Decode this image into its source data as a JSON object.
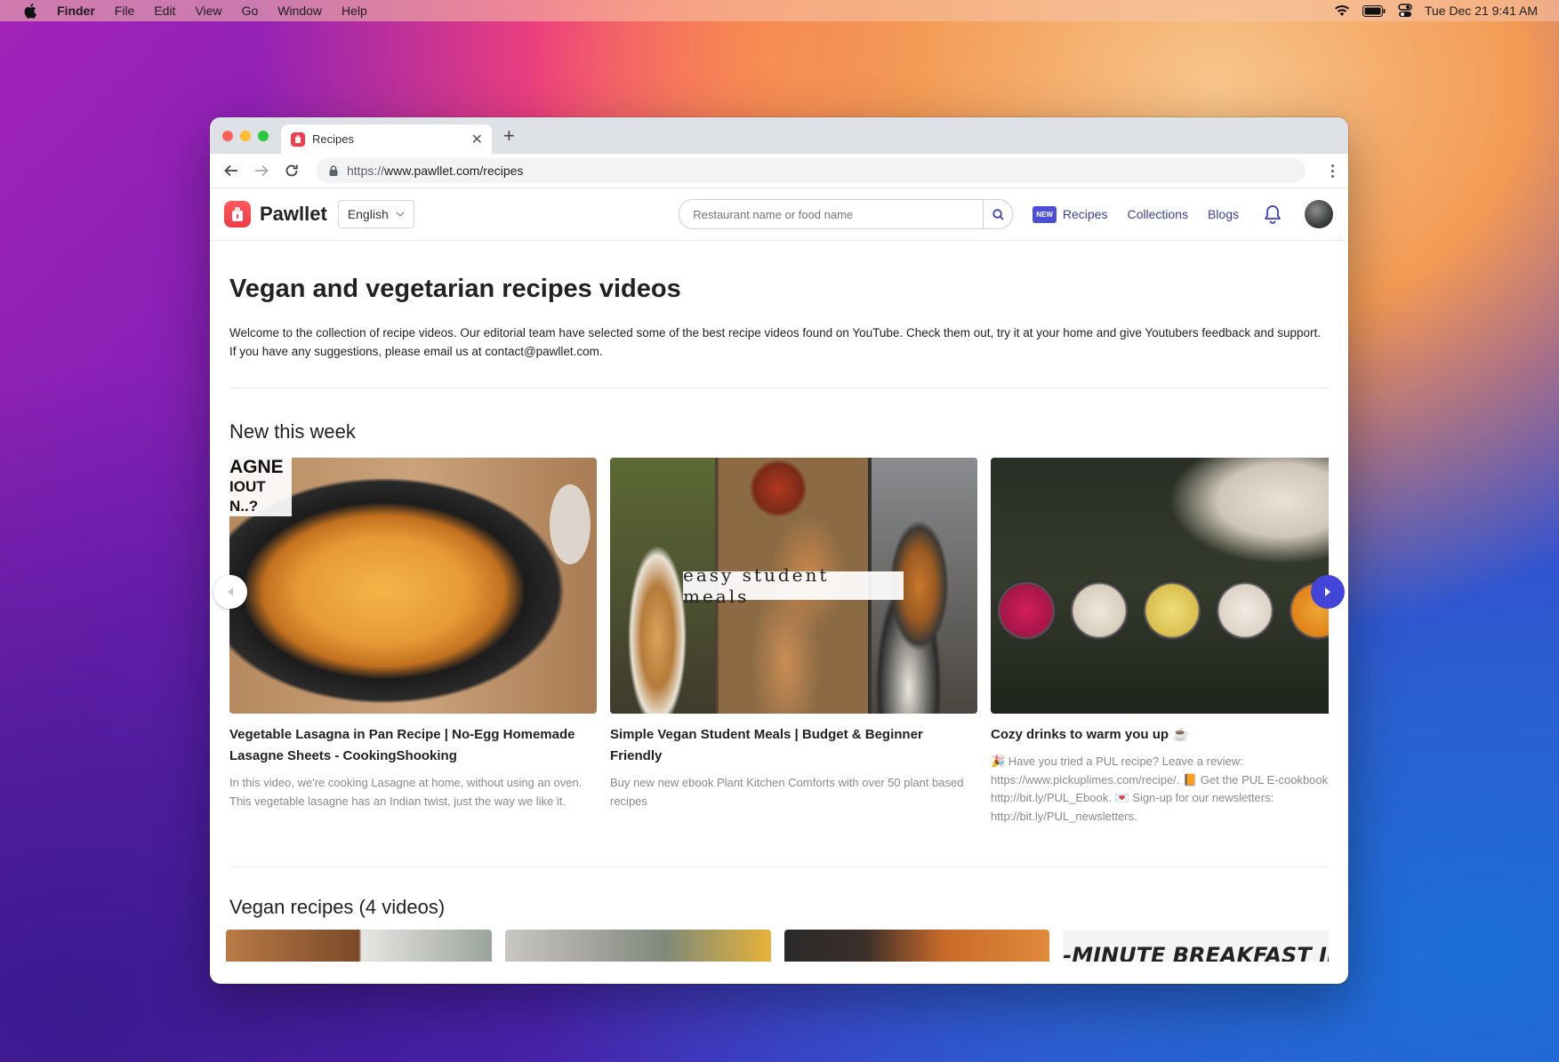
{
  "menubar": {
    "app": "Finder",
    "items": [
      "File",
      "Edit",
      "View",
      "Go",
      "Window",
      "Help"
    ],
    "datetime": "Tue Dec 21  9:41 AM"
  },
  "browser": {
    "tab_title": "Recipes",
    "url_scheme": "https://",
    "url_rest": "www.pawllet.com/recipes"
  },
  "header": {
    "brand": "Pawllet",
    "language": "English",
    "search_placeholder": "Restaurant name or food name",
    "new_badge": "NEW",
    "nav": [
      "Recipes",
      "Collections",
      "Blogs"
    ]
  },
  "main": {
    "title": "Vegan and vegetarian recipes videos",
    "intro": "Welcome to the collection of recipe videos. Our editorial team have selected some of the best recipe videos found on YouTube. Check them out, try it at your home and give Youtubers feedback and support. If you have any suggestions, please email us at contact@pawllet.com.",
    "new_section": "New this week",
    "cards": [
      {
        "thumb_text_1": "AGNE",
        "thumb_text_2": "IOUT",
        "thumb_text_3": "N..?",
        "title": "Vegetable Lasagna in Pan Recipe | No-Egg Homemade Lasagne Sheets - CookingShooking",
        "desc": "In this video, we're cooking Lasagne at home, without using an oven. This vegetable lasagne has an Indian twist, just the way we like it."
      },
      {
        "thumb_text": "easy student meals",
        "title": "Simple Vegan Student Meals | Budget & Beginner Friendly",
        "desc": "Buy new new ebook Plant Kitchen Comforts with over 50 plant based recipes"
      },
      {
        "title": "Cozy drinks to warm you up ☕",
        "desc": "🎉 Have you tried a PUL recipe? Leave a review: https://www.pickuplimes.com/recipe/. 📙 Get the PUL E-cookbook http://bit.ly/PUL_Ebook. 💌 Sign-up for our newsletters: http://bit.ly/PUL_newsletters."
      }
    ],
    "vegan_section": "Vegan recipes (4 videos)",
    "vegan_thumb_text": "-MINUTE BREAKFAST IDEA"
  },
  "colors": {
    "accent": "#4344d8",
    "brand_red": "#ef3b45",
    "nav_text": "#3b3f9c"
  }
}
